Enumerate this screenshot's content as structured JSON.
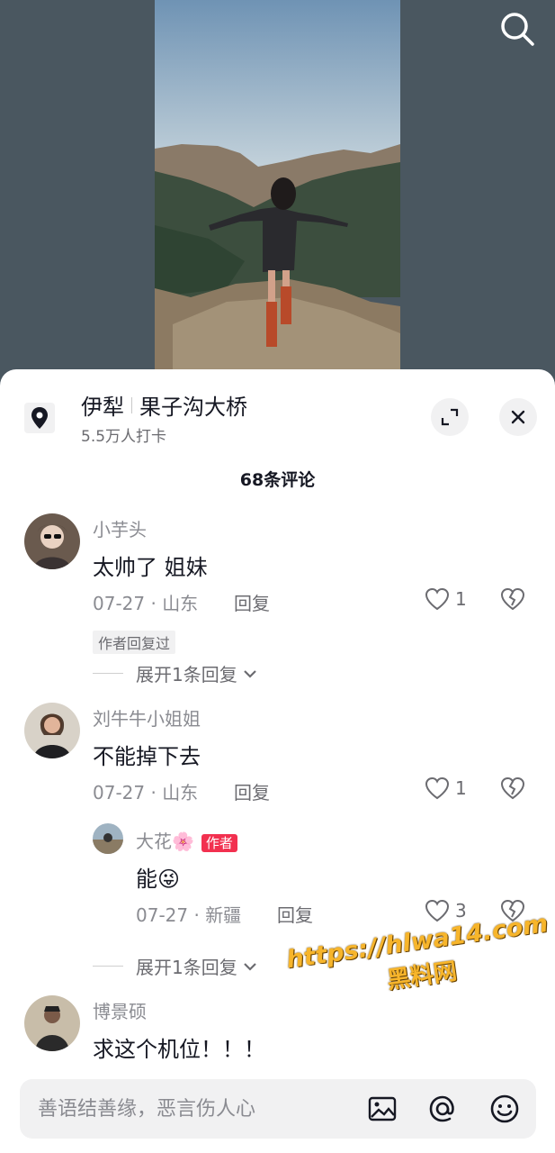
{
  "location": {
    "city": "伊犁",
    "place": "果子沟大桥",
    "checkins": "5.5万人打卡",
    "icon": "location-pin-icon"
  },
  "comment_count": "68条评论",
  "comments": [
    {
      "username": "小芋头",
      "text": "太帅了 姐妹",
      "date_region": "07-27 · 山东",
      "reply_label": "回复",
      "likes": "1",
      "author_replied_tag": "作者回复过",
      "expand_label": "展开1条回复"
    },
    {
      "username": "刘牛牛小姐姐",
      "text": "不能掉下去",
      "date_region": "07-27 · 山东",
      "reply_label": "回复",
      "likes": "1",
      "reply": {
        "username": "大花🌸",
        "badge": "作者",
        "text": "能😜",
        "date_region": "07-27 · 新疆",
        "reply_label": "回复",
        "likes": "3"
      },
      "expand_label": "展开1条回复"
    },
    {
      "username": "博景硕",
      "text": "求这个机位！！！"
    }
  ],
  "input": {
    "placeholder": "善语结善缘，恶言伤人心"
  },
  "watermark": {
    "url": "https://hlwa14.com",
    "name": "黑料网"
  },
  "colors": {
    "author_badge": "#f2304f",
    "watermark": "#f7b52b"
  }
}
